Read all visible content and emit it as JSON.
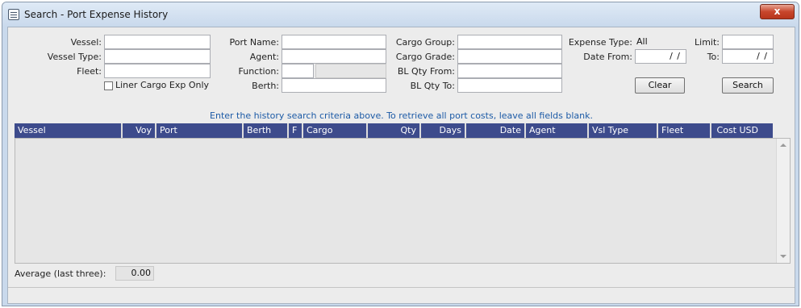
{
  "window": {
    "title": "Search - Port Expense History",
    "close_glyph": "x"
  },
  "form": {
    "vessel_label": "Vessel:",
    "vessel_type_label": "Vessel Type:",
    "fleet_label": "Fleet:",
    "liner_label": "Liner Cargo Exp Only",
    "liner_checked": false,
    "port_name_label": "Port Name:",
    "agent_label": "Agent:",
    "function_label": "Function:",
    "berth_label": "Berth:",
    "cargo_group_label": "Cargo Group:",
    "cargo_grade_label": "Cargo Grade:",
    "bl_qty_from_label": "BL Qty From:",
    "bl_qty_to_label": "BL Qty To:",
    "expense_type_label": "Expense Type:",
    "expense_type_value": "All",
    "limit_label": "Limit:",
    "date_from_label": "Date From:",
    "date_from_value": "/ /",
    "to_label": "To:",
    "to_value": "/ /",
    "clear_label": "Clear",
    "search_label": "Search"
  },
  "hint": "Enter the history search criteria above.  To retrieve all port costs, leave all fields blank.",
  "grid": {
    "columns": [
      "Vessel",
      "Voy",
      "Port",
      "Berth",
      "F",
      "Cargo",
      "Qty",
      "Days",
      "Date",
      "Agent",
      "Vsl Type",
      "Fleet",
      "Cost USD"
    ]
  },
  "footer": {
    "average_label": "Average (last three):",
    "average_value": "0.00"
  }
}
